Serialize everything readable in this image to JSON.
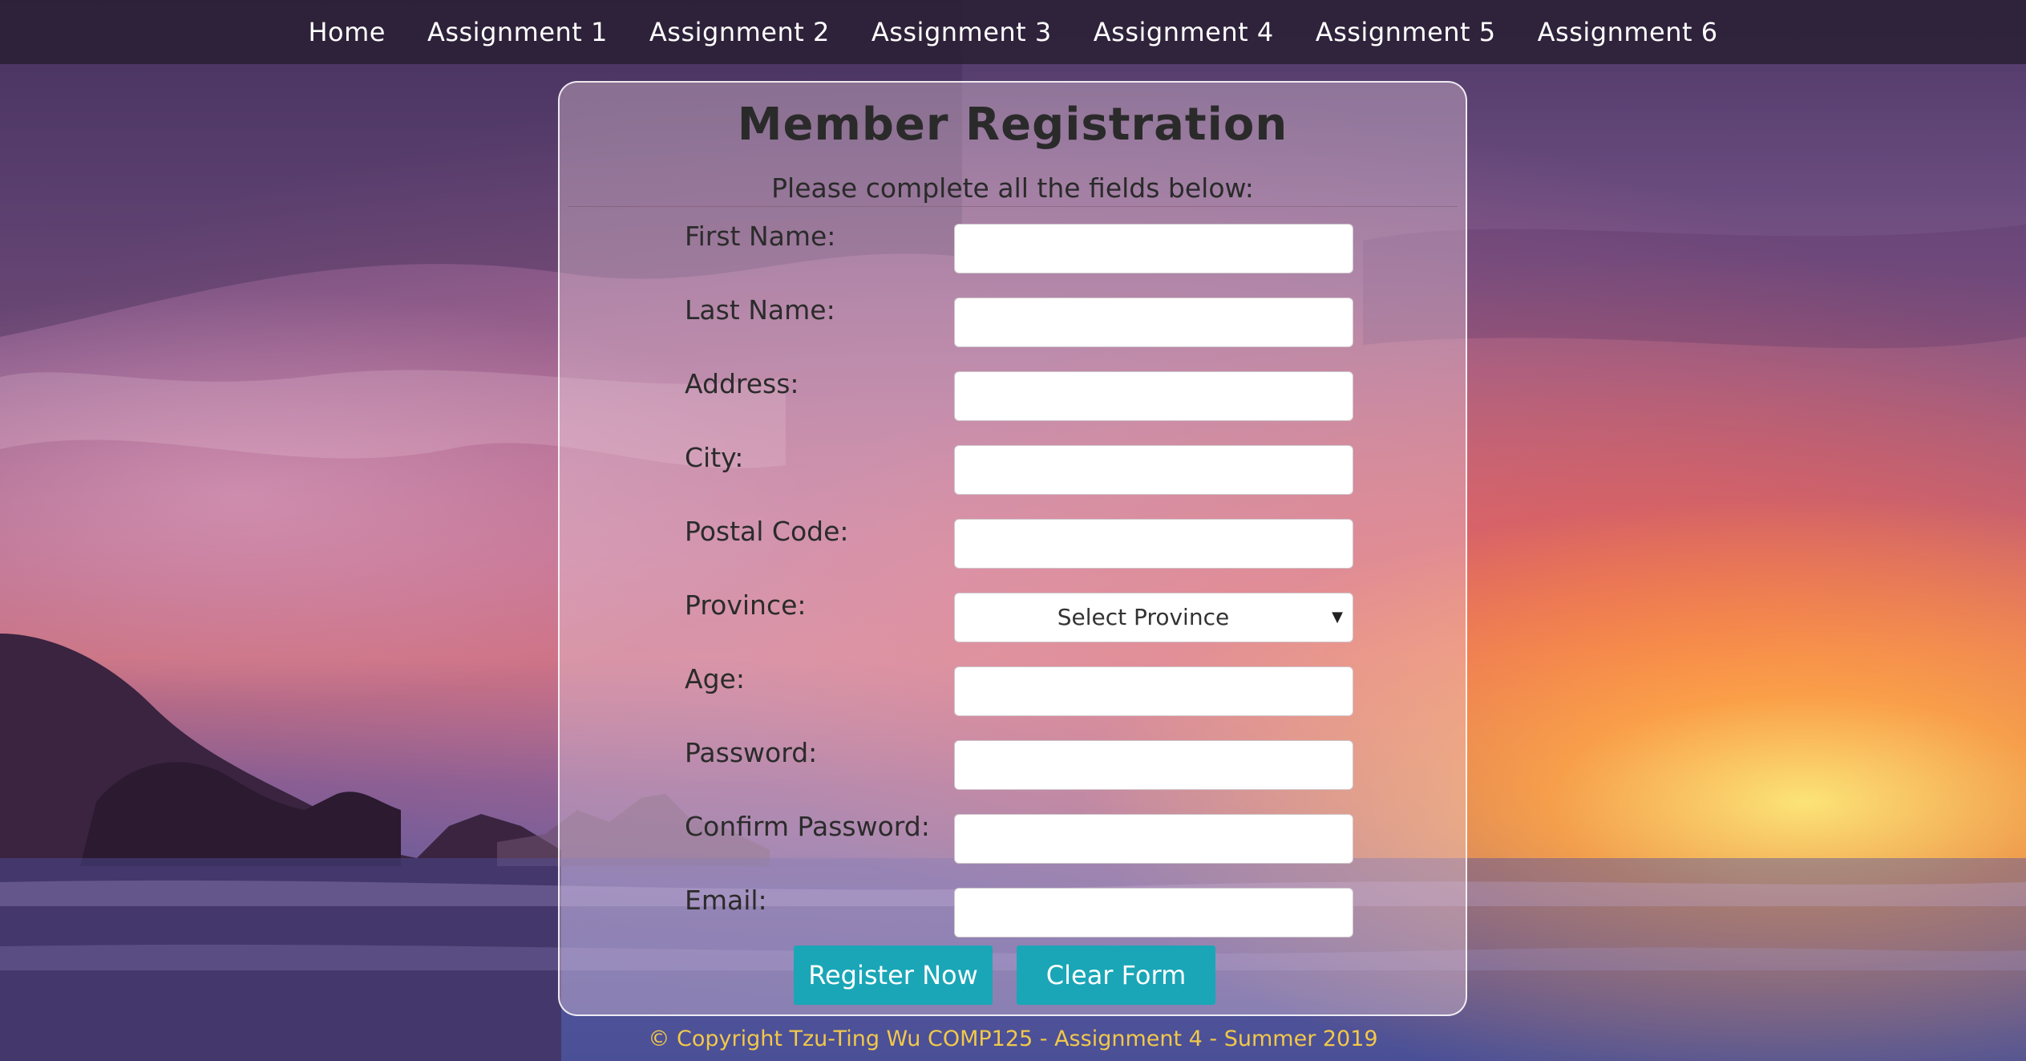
{
  "nav": {
    "items": [
      {
        "label": "Home"
      },
      {
        "label": "Assignment 1"
      },
      {
        "label": "Assignment 2"
      },
      {
        "label": "Assignment 3"
      },
      {
        "label": "Assignment 4"
      },
      {
        "label": "Assignment 5"
      },
      {
        "label": "Assignment 6"
      }
    ]
  },
  "form": {
    "title": "Member Registration",
    "subtitle": "Please complete all the fields below:",
    "fields": [
      {
        "label": "First Name:",
        "value": ""
      },
      {
        "label": "Last Name:",
        "value": ""
      },
      {
        "label": "Address:",
        "value": ""
      },
      {
        "label": "City:",
        "value": ""
      },
      {
        "label": "Postal Code:",
        "value": ""
      },
      {
        "label": "Province:",
        "selected": "Select Province"
      },
      {
        "label": "Age:",
        "value": ""
      },
      {
        "label": "Password:",
        "value": ""
      },
      {
        "label": "Confirm Password:",
        "value": ""
      },
      {
        "label": "Email:",
        "value": ""
      }
    ],
    "register_label": "Register Now",
    "clear_label": "Clear Form"
  },
  "footer": {
    "text": "© Copyright Tzu-Ting Wu COMP125 - Assignment 4 - Summer 2019"
  },
  "colors": {
    "button": "#1aa6b7",
    "footer_text": "#f2c84a",
    "navbar": "#281e32"
  },
  "icons": {
    "select_arrow": "chevron-down-icon"
  }
}
